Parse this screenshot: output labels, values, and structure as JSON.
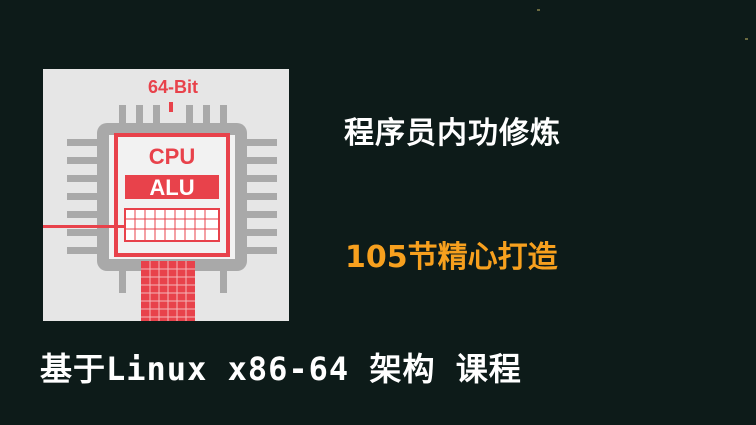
{
  "graphic": {
    "bit_label": "64-Bit",
    "cpu_label": "CPU",
    "alu_label": "ALU",
    "accent_color": "#e8424b",
    "chip_color": "#a9a9a9"
  },
  "texts": {
    "headline": "程序员内功修炼",
    "subline": "105节精心打造",
    "footer": "基于Linux x86-64 架构 课程"
  },
  "colors": {
    "background": "#0d1b19",
    "headline": "#ffffff",
    "subline": "#f7a01e"
  }
}
